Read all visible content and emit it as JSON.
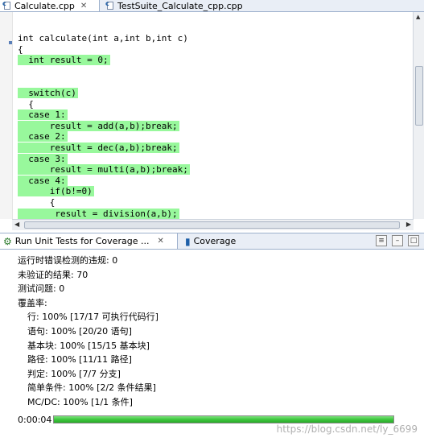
{
  "editor_tabs": [
    {
      "label": "Calculate.cpp",
      "active": true,
      "icon": "c-file-icon"
    },
    {
      "label": "TestSuite_Calculate_cpp.cpp",
      "active": false,
      "icon": "c-file-icon"
    }
  ],
  "code_lines": [
    {
      "text": "int calculate(int a,int b,int c)",
      "hl": false
    },
    {
      "text": "{",
      "hl": false
    },
    {
      "text": "  int result = 0;",
      "hl": true
    },
    {
      "text": "",
      "hl": false
    },
    {
      "text": "",
      "hl": false
    },
    {
      "text": "  switch(c)",
      "hl": true
    },
    {
      "text": "  {",
      "hl": false
    },
    {
      "text": "  case 1:",
      "hl": true
    },
    {
      "text": "      result = add(a,b);break;",
      "hl": true
    },
    {
      "text": "  case 2:",
      "hl": true
    },
    {
      "text": "      result = dec(a,b);break;",
      "hl": true
    },
    {
      "text": "  case 3:",
      "hl": true
    },
    {
      "text": "      result = multi(a,b);break;",
      "hl": true
    },
    {
      "text": "  case 4:",
      "hl": true
    },
    {
      "text": "      if(b!=0)",
      "hl": true
    },
    {
      "text": "      {",
      "hl": false
    },
    {
      "text": "       result = division(a,b);",
      "hl": true
    }
  ],
  "view_tabs": [
    {
      "label": "Run Unit Tests for Coverage ...",
      "active": true,
      "icon": "gear-icon"
    },
    {
      "label": "Coverage",
      "active": false,
      "icon": "bar-chart-icon"
    }
  ],
  "results": {
    "violations": "运行时错误检测的违规: 0",
    "unverified": "未验证的结果: 70",
    "test_problems": "测试问题: 0",
    "coverage_heading": "覆盖率:",
    "coverage_items": [
      "行: 100% [17/17 可执行代码行]",
      "语句: 100% [20/20 语句]",
      "基本块: 100% [15/15 基本块]",
      "路径: 100% [11/11 路径]",
      "判定: 100% [7/7 分支]",
      "简单条件: 100% [2/2 条件结果]",
      "MC/DC: 100% [1/1 条件]"
    ]
  },
  "progress": {
    "time": "0:00:04",
    "fraction": 1.0,
    "color": "#3ec73e"
  },
  "watermark": "https://blog.csdn.net/ly_6699",
  "colors": {
    "highlight": "#98f89c",
    "keyword": "#7f0055"
  }
}
